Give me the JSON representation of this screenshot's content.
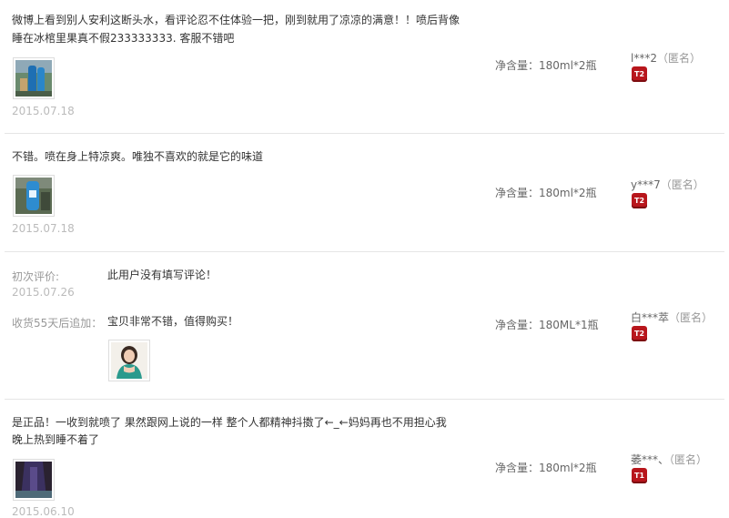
{
  "reviews": [
    {
      "content_line1": "微博上看到别人安利这断头水，看评论忍不住体验一把，刚到就用了凉凉的满意！！喷后背像",
      "content_line2": "睡在冰棺里果真不假233333333. 客服不错吧",
      "date": "2015.07.18",
      "spec": "净含量：180ml*2瓶",
      "user": "l***2",
      "anon": "（匿名）",
      "level": "T2"
    },
    {
      "content_line1": "不错。喷在身上特凉爽。唯独不喜欢的就是它的味道",
      "date": "2015.07.18",
      "spec": "净含量：180ml*2瓶",
      "user": "y***7",
      "anon": "（匿名）",
      "level": "T2"
    },
    {
      "initial_label": "初次评价:",
      "initial_content": "此用户没有填写评论！",
      "date": "2015.07.26",
      "append_label": "收货55天后追加：",
      "append_content": "宝贝非常不错，值得购买！",
      "spec": "净含量：180ML*1瓶",
      "user": "白***萃",
      "anon": "（匿名）",
      "level": "T2"
    },
    {
      "content_line1": "是正品！一收到就喷了 果然跟网上说的一样 整个人都精神抖擞了←_←妈妈再也不用担心我",
      "content_line2": "晚上热到睡不着了",
      "date": "2015.06.10",
      "spec": "净含量：180ml*2瓶",
      "user": "萎***、",
      "anon": "（匿名）",
      "level": "T1"
    }
  ],
  "colors": {
    "badge": "#b8161c",
    "date": "#bbbbbb",
    "divider": "#e5e5e5"
  }
}
